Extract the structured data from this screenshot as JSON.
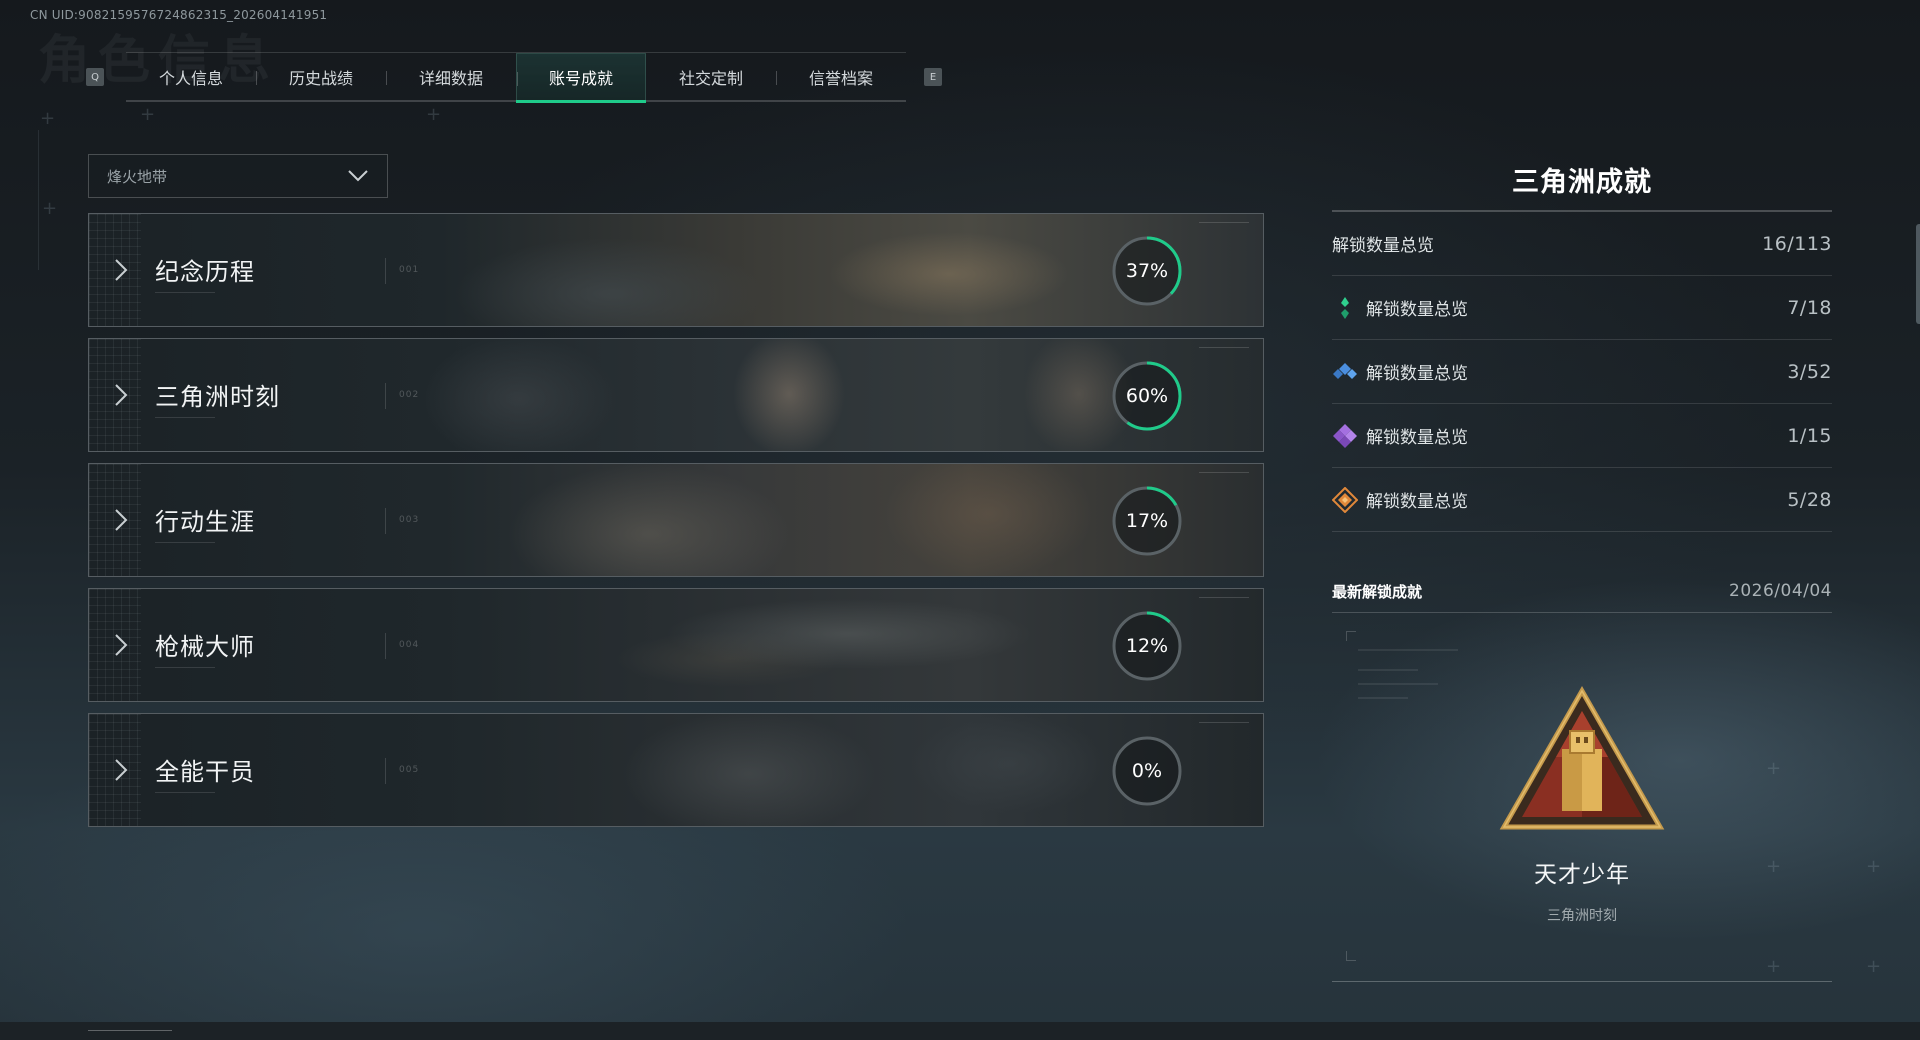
{
  "uid_text": "CN UID:90821595767248623​15_202604141951",
  "tabbar": {
    "left_key": "Q",
    "right_key": "E",
    "tabs": [
      {
        "label": "个人信息"
      },
      {
        "label": "历史战绩"
      },
      {
        "label": "详细数据"
      },
      {
        "label": "账号成就",
        "active": true
      },
      {
        "label": "社交定制"
      },
      {
        "label": "信誉档案"
      }
    ]
  },
  "dropdown": {
    "selected": "烽火地带",
    "icon": "chevron-down-icon"
  },
  "categories": [
    {
      "title": "纪念历程",
      "code": "001",
      "percent_text": "37%",
      "progress": 0.37
    },
    {
      "title": "三角洲时刻",
      "code": "002",
      "percent_text": "60%",
      "progress": 0.6
    },
    {
      "title": "行动生涯",
      "code": "003",
      "percent_text": "17%",
      "progress": 0.17
    },
    {
      "title": "枪械大师",
      "code": "004",
      "percent_text": "12%",
      "progress": 0.12
    },
    {
      "title": "全能干员",
      "code": "005",
      "percent_text": "0%",
      "progress": 0.0
    }
  ],
  "panel": {
    "title": "三角洲成就",
    "stats": [
      {
        "label": "解锁数量总览",
        "value": "16/113",
        "icon": "none"
      },
      {
        "label": "解锁数量总览",
        "value": "7/18",
        "icon": "green-diamond-icon",
        "color": "#2fd08e"
      },
      {
        "label": "解锁数量总览",
        "value": "3/52",
        "icon": "blue-diamond-icon",
        "color": "#4b8fe0"
      },
      {
        "label": "解锁数量总览",
        "value": "1/15",
        "icon": "purple-diamond-icon",
        "color": "#9a62d6"
      },
      {
        "label": "解锁数量总览",
        "value": "5/28",
        "icon": "orange-diamond-icon",
        "color": "#e0883a"
      }
    ],
    "latest": {
      "label": "最新解锁成就",
      "date": "2026/04/04",
      "name": "天才少年",
      "category": "三角洲时刻",
      "icon": "triangle-badge-icon"
    }
  },
  "colors": {
    "accent": "#1fcb8a",
    "ring_track": "#5a6266"
  }
}
